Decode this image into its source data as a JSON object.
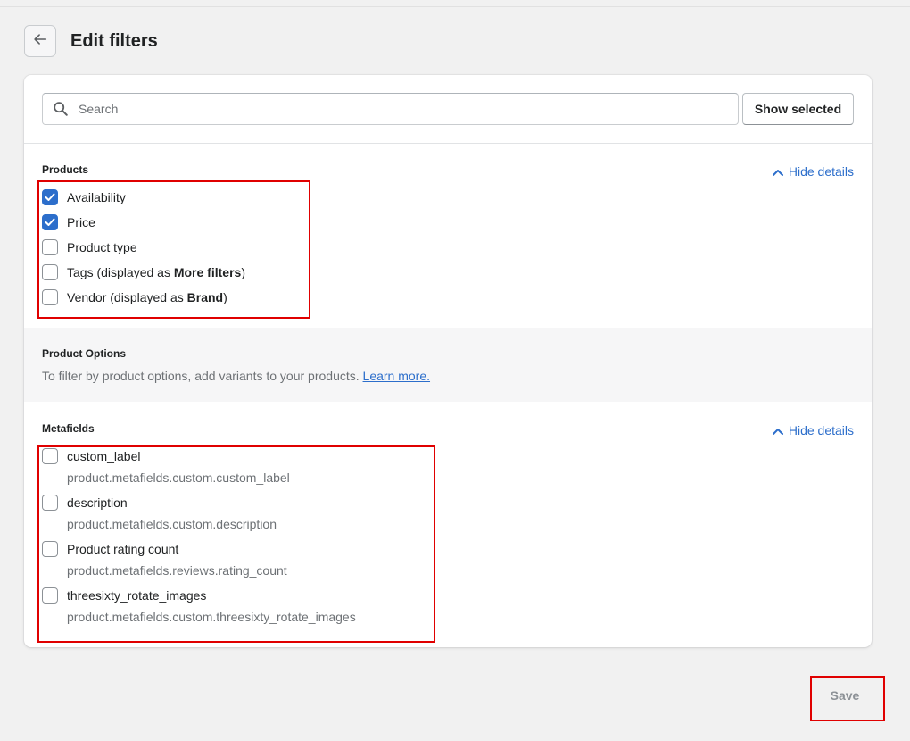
{
  "header": {
    "title": "Edit filters",
    "back_icon": "arrow-left-icon"
  },
  "search": {
    "placeholder": "Search",
    "value": "",
    "show_selected_label": "Show selected"
  },
  "products": {
    "title": "Products",
    "hide_details_label": "Hide details",
    "items": [
      {
        "label": "Availability",
        "checked": true
      },
      {
        "label": "Price",
        "checked": true
      },
      {
        "label": "Product type",
        "checked": false
      },
      {
        "label": "Tags (displayed as ",
        "bold": "More filters",
        "suffix": ")",
        "checked": false
      },
      {
        "label": "Vendor (displayed as ",
        "bold": "Brand",
        "suffix": ")",
        "checked": false
      }
    ]
  },
  "product_options": {
    "title": "Product Options",
    "description": "To filter by product options, add variants to your products.",
    "learn_more": "Learn more."
  },
  "metafields": {
    "title": "Metafields",
    "hide_details_label": "Hide details",
    "items": [
      {
        "label": "custom_label",
        "path": "product.metafields.custom.custom_label",
        "checked": false
      },
      {
        "label": "description",
        "path": "product.metafields.custom.description",
        "checked": false
      },
      {
        "label": "Product rating count",
        "path": "product.metafields.reviews.rating_count",
        "checked": false
      },
      {
        "label": "threesixty_rotate_images",
        "path": "product.metafields.custom.threesixty_rotate_images",
        "checked": false
      }
    ]
  },
  "footer": {
    "save_label": "Save"
  },
  "colors": {
    "accent": "#2c6ecb",
    "annotation": "#e00000"
  }
}
